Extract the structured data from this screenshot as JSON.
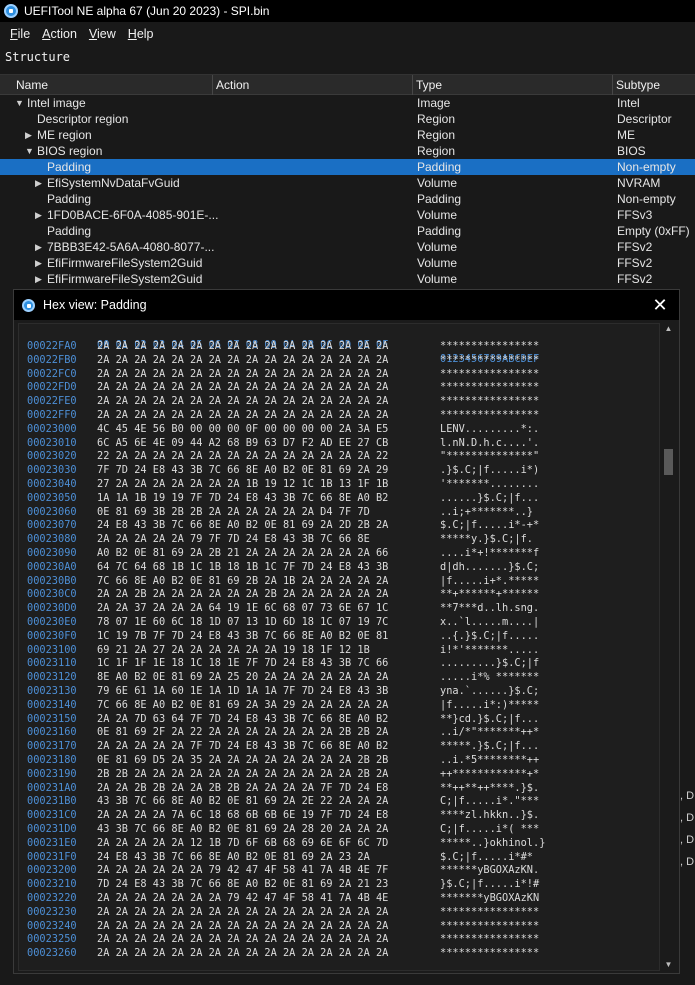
{
  "app": {
    "title": "UEFITool NE alpha 67 (Jun 20 2023) - SPI.bin"
  },
  "menu": {
    "items": [
      {
        "u": "F",
        "rest": "ile"
      },
      {
        "u": "A",
        "rest": "ction"
      },
      {
        "u": "V",
        "rest": "iew"
      },
      {
        "u": "H",
        "rest": "elp"
      }
    ]
  },
  "structure": {
    "label": "Structure",
    "columns": [
      "Name",
      "Action",
      "Type",
      "Subtype"
    ],
    "rows": [
      {
        "name": "Intel image",
        "type": "Image",
        "subtype": "Intel",
        "arrow": "down",
        "indent": 0
      },
      {
        "name": "Descriptor region",
        "type": "Region",
        "subtype": "Descriptor",
        "arrow": "",
        "indent": 1
      },
      {
        "name": "ME region",
        "type": "Region",
        "subtype": "ME",
        "arrow": "right",
        "indent": 1
      },
      {
        "name": "BIOS region",
        "type": "Region",
        "subtype": "BIOS",
        "arrow": "down",
        "indent": 1
      },
      {
        "name": "Padding",
        "type": "Padding",
        "subtype": "Non-empty",
        "arrow": "",
        "indent": 2,
        "selected": true
      },
      {
        "name": "EfiSystemNvDataFvGuid",
        "type": "Volume",
        "subtype": "NVRAM",
        "arrow": "right",
        "indent": 2
      },
      {
        "name": "Padding",
        "type": "Padding",
        "subtype": "Non-empty",
        "arrow": "",
        "indent": 2
      },
      {
        "name": "1FD0BACE-6F0A-4085-901E-...",
        "type": "Volume",
        "subtype": "FFSv3",
        "arrow": "right",
        "indent": 2
      },
      {
        "name": "Padding",
        "type": "Padding",
        "subtype": "Empty (0xFF)",
        "arrow": "",
        "indent": 2
      },
      {
        "name": "7BBB3E42-5A6A-4080-8077-...",
        "type": "Volume",
        "subtype": "FFSv2",
        "arrow": "right",
        "indent": 2
      },
      {
        "name": "EfiFirmwareFileSystem2Guid",
        "type": "Volume",
        "subtype": "FFSv2",
        "arrow": "right",
        "indent": 2
      },
      {
        "name": "EfiFirmwareFileSystem2Guid",
        "type": "Volume",
        "subtype": "FFSv2",
        "arrow": "right",
        "indent": 2
      }
    ]
  },
  "right_fragments": [
    ", D",
    ", D",
    ", D",
    ", D"
  ],
  "hexview": {
    "title": "Hex view: Padding",
    "header_bytes": "00 01 02 03 04 05 06 07 08 09 0A 0B 0C 0D 0E 0F",
    "header_ascii": "0123456789ABCDEF",
    "lines": [
      {
        "off": "00022FA0",
        "hex": "2A 2A 2A 2A 2A 2A 2A 2A 2A 2A 2A 2A 2A 2A 2A 2A",
        "ascii": "****************"
      },
      {
        "off": "00022FB0",
        "hex": "2A 2A 2A 2A 2A 2A 2A 2A 2A 2A 2A 2A 2A 2A 2A 2A",
        "ascii": "****************"
      },
      {
        "off": "00022FC0",
        "hex": "2A 2A 2A 2A 2A 2A 2A 2A 2A 2A 2A 2A 2A 2A 2A 2A",
        "ascii": "****************"
      },
      {
        "off": "00022FD0",
        "hex": "2A 2A 2A 2A 2A 2A 2A 2A 2A 2A 2A 2A 2A 2A 2A 2A",
        "ascii": "****************"
      },
      {
        "off": "00022FE0",
        "hex": "2A 2A 2A 2A 2A 2A 2A 2A 2A 2A 2A 2A 2A 2A 2A 2A",
        "ascii": "****************"
      },
      {
        "off": "00022FF0",
        "hex": "2A 2A 2A 2A 2A 2A 2A 2A 2A 2A 2A 2A 2A 2A 2A 2A",
        "ascii": "****************"
      },
      {
        "off": "00023000",
        "hex": "4C 45 4E 56 B0 00 00 00 0F 00 00 00 00 2A 3A E5",
        "ascii": "LENV.........*:."
      },
      {
        "off": "00023010",
        "hex": "6C A5 6E 4E 09 44 A2 68 B9 63 D7 F2 AD EE 27 CB",
        "ascii": "l.nN.D.h.c....'."
      },
      {
        "off": "00023020",
        "hex": "22 2A 2A 2A 2A 2A 2A 2A 2A 2A 2A 2A 2A 2A 2A 22",
        "ascii": "\"**************\""
      },
      {
        "off": "00023030",
        "hex": "7F 7D 24 E8 43 3B 7C 66 8E A0 B2 0E 81 69 2A 29",
        "ascii": ".}$.C;|f.....i*)"
      },
      {
        "off": "00023040",
        "hex": "27 2A 2A 2A 2A 2A 2A 2A 1B 19 12 1C 1B 13 1F 1B",
        "ascii": "'*******........"
      },
      {
        "off": "00023050",
        "hex": "1A 1A 1B 19 19 7F 7D 24 E8 43 3B 7C 66 8E A0 B2",
        "ascii": "......}$.C;|f..."
      },
      {
        "off": "00023060",
        "hex": "0E 81 69 3B 2B 2B 2A 2A 2A 2A 2A 2A D4 7F 7D",
        "ascii": "..i;+*******..}"
      },
      {
        "off": "00023070",
        "hex": "24 E8 43 3B 7C 66 8E A0 B2 0E 81 69 2A 2D 2B 2A",
        "ascii": "$.C;|f.....i*-+*"
      },
      {
        "off": "00023080",
        "hex": "2A 2A 2A 2A 2A 79 7F 7D 24 E8 43 3B 7C 66 8E",
        "ascii": "*****y.}$.C;|f."
      },
      {
        "off": "00023090",
        "hex": "A0 B2 0E 81 69 2A 2B 21 2A 2A 2A 2A 2A 2A 2A 66",
        "ascii": "....i*+!*******f"
      },
      {
        "off": "000230A0",
        "hex": "64 7C 64 68 1B 1C 1B 18 1B 1C 7F 7D 24 E8 43 3B",
        "ascii": "d|dh.......}$.C;"
      },
      {
        "off": "000230B0",
        "hex": "7C 66 8E A0 B2 0E 81 69 2B 2A 1B 2A 2A 2A 2A 2A",
        "ascii": "|f.....i+*.*****"
      },
      {
        "off": "000230C0",
        "hex": "2A 2A 2B 2A 2A 2A 2A 2A 2A 2B 2A 2A 2A 2A 2A 2A",
        "ascii": "**+******+******"
      },
      {
        "off": "000230D0",
        "hex": "2A 2A 37 2A 2A 2A 64 19 1E 6C 68 07 73 6E 67 1C",
        "ascii": "**7***d..lh.sng."
      },
      {
        "off": "000230E0",
        "hex": "78 07 1E 60 6C 18 1D 07 13 1D 6D 18 1C 07 19 7C",
        "ascii": "x..`l.....m....|"
      },
      {
        "off": "000230F0",
        "hex": "1C 19 7B 7F 7D 24 E8 43 3B 7C 66 8E A0 B2 0E 81",
        "ascii": "..{.}$.C;|f....."
      },
      {
        "off": "00023100",
        "hex": "69 21 2A 27 2A 2A 2A 2A 2A 2A 19 18 1F 12 1B",
        "ascii": "i!*'*******....."
      },
      {
        "off": "00023110",
        "hex": "1C 1F 1F 1E 18 1C 18 1E 7F 7D 24 E8 43 3B 7C 66",
        "ascii": ".........}$.C;|f"
      },
      {
        "off": "00023120",
        "hex": "8E A0 B2 0E 81 69 2A 25 20 2A 2A 2A 2A 2A 2A 2A",
        "ascii": ".....i*% *******"
      },
      {
        "off": "00023130",
        "hex": "79 6E 61 1A 60 1E 1A 1D 1A 1A 7F 7D 24 E8 43 3B",
        "ascii": "yna.`......}$.C;"
      },
      {
        "off": "00023140",
        "hex": "7C 66 8E A0 B2 0E 81 69 2A 3A 29 2A 2A 2A 2A 2A",
        "ascii": "|f.....i*:)*****"
      },
      {
        "off": "00023150",
        "hex": "2A 2A 7D 63 64 7F 7D 24 E8 43 3B 7C 66 8E A0 B2",
        "ascii": "**}cd.}$.C;|f..."
      },
      {
        "off": "00023160",
        "hex": "0E 81 69 2F 2A 22 2A 2A 2A 2A 2A 2A 2A 2B 2B 2A",
        "ascii": "..i/*\"*******++*"
      },
      {
        "off": "00023170",
        "hex": "2A 2A 2A 2A 2A 7F 7D 24 E8 43 3B 7C 66 8E A0 B2",
        "ascii": "*****.}$.C;|f..."
      },
      {
        "off": "00023180",
        "hex": "0E 81 69 D5 2A 35 2A 2A 2A 2A 2A 2A 2A 2A 2B 2B",
        "ascii": "..i.*5********++"
      },
      {
        "off": "00023190",
        "hex": "2B 2B 2A 2A 2A 2A 2A 2A 2A 2A 2A 2A 2A 2A 2B 2A",
        "ascii": "++************+*"
      },
      {
        "off": "000231A0",
        "hex": "2A 2A 2B 2B 2A 2A 2B 2B 2A 2A 2A 2A 7F 7D 24 E8",
        "ascii": "**++**++****.}$."
      },
      {
        "off": "000231B0",
        "hex": "43 3B 7C 66 8E A0 B2 0E 81 69 2A 2E 22 2A 2A 2A",
        "ascii": "C;|f.....i*.\"***"
      },
      {
        "off": "000231C0",
        "hex": "2A 2A 2A 2A 7A 6C 18 68 6B 6B 6E 19 7F 7D 24 E8",
        "ascii": "****zl.hkkn..}$."
      },
      {
        "off": "000231D0",
        "hex": "43 3B 7C 66 8E A0 B2 0E 81 69 2A 28 20 2A 2A 2A",
        "ascii": "C;|f.....i*( ***"
      },
      {
        "off": "000231E0",
        "hex": "2A 2A 2A 2A 2A 12 1B 7D 6F 6B 68 69 6E 6F 6C 7D",
        "ascii": "*****..}okhinol.}"
      },
      {
        "off": "000231F0",
        "hex": "24 E8 43 3B 7C 66 8E A0 B2 0E 81 69 2A 23 2A",
        "ascii": "$.C;|f.....i*#*"
      },
      {
        "off": "00023200",
        "hex": "2A 2A 2A 2A 2A 2A 79 42 47 4F 58 41 7A 4B 4E 7F",
        "ascii": "******yBGOXAzKN."
      },
      {
        "off": "00023210",
        "hex": "7D 24 E8 43 3B 7C 66 8E A0 B2 0E 81 69 2A 21 23",
        "ascii": "}$.C;|f.....i*!#"
      },
      {
        "off": "00023220",
        "hex": "2A 2A 2A 2A 2A 2A 2A 79 42 47 4F 58 41 7A 4B 4E",
        "ascii": "*******yBGOXAzKN"
      },
      {
        "off": "00023230",
        "hex": "2A 2A 2A 2A 2A 2A 2A 2A 2A 2A 2A 2A 2A 2A 2A 2A",
        "ascii": "****************"
      },
      {
        "off": "00023240",
        "hex": "2A 2A 2A 2A 2A 2A 2A 2A 2A 2A 2A 2A 2A 2A 2A 2A",
        "ascii": "****************"
      },
      {
        "off": "00023250",
        "hex": "2A 2A 2A 2A 2A 2A 2A 2A 2A 2A 2A 2A 2A 2A 2A 2A",
        "ascii": "****************"
      },
      {
        "off": "00023260",
        "hex": "2A 2A 2A 2A 2A 2A 2A 2A 2A 2A 2A 2A 2A 2A 2A 2A",
        "ascii": "****************"
      }
    ]
  }
}
